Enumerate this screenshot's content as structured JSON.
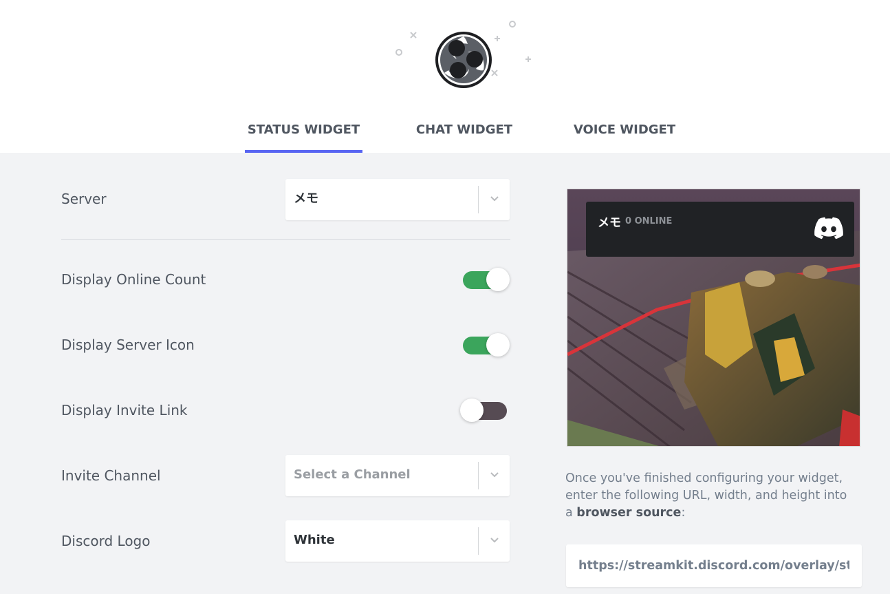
{
  "header": {
    "logo": "obs-logo-icon",
    "tabs": [
      {
        "label": "STATUS WIDGET",
        "active": true
      },
      {
        "label": "CHAT WIDGET",
        "active": false
      },
      {
        "label": "VOICE WIDGET",
        "active": false
      }
    ]
  },
  "settings": {
    "server": {
      "label": "Server",
      "value": "メモ"
    },
    "online_count": {
      "label": "Display Online Count",
      "enabled": true
    },
    "server_icon": {
      "label": "Display Server Icon",
      "enabled": true
    },
    "invite_link": {
      "label": "Display Invite Link",
      "enabled": false
    },
    "invite_channel": {
      "label": "Invite Channel",
      "placeholder": "Select a Channel"
    },
    "discord_logo": {
      "label": "Discord Logo",
      "value": "White"
    }
  },
  "preview": {
    "server_name": "メモ",
    "online_text": "0 ONLINE",
    "logo_icon": "discord-icon"
  },
  "instructions": {
    "text_before": "Once you've finished configuring your widget, enter the following URL, width, and height into a ",
    "emphasis": "browser source",
    "text_after": ":",
    "url": "https://streamkit.discord.com/overlay/status"
  },
  "colors": {
    "accent": "#5865f2",
    "toggle_on": "#3ba55c",
    "toggle_off": "#564b53",
    "background": "#f2f3f5"
  }
}
